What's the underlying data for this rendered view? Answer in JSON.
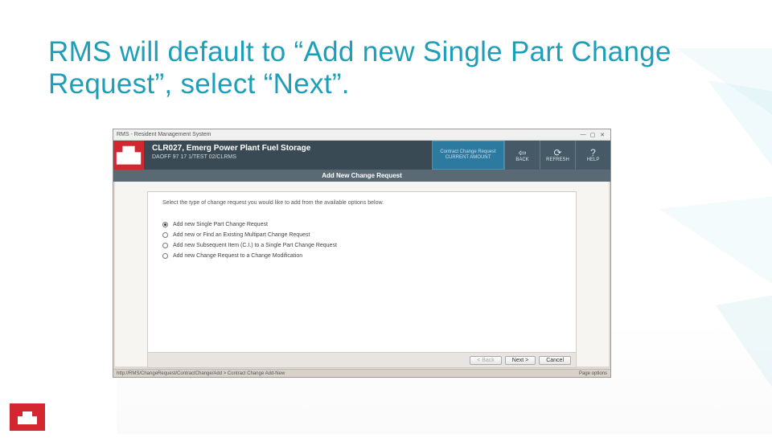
{
  "slide": {
    "title": "RMS will default to “Add new Single Part Change Request”, select “Next”."
  },
  "app": {
    "window_title": "RMS - Resident Management System",
    "header_title": "CLR027, Emerg Power Plant Fuel Storage",
    "header_subtitle": "DAOFF 97 17 1/TEST 02/CLRMS",
    "summary_box": {
      "line1": "Contract Change Request",
      "line2": "CURRENT AMOUNT"
    },
    "action_back": "BACK",
    "action_refresh": "REFRESH",
    "action_help": "HELP",
    "section_title": "Add New Change Request",
    "form_intro": "Select the type of change request you would like to add from the available options below.",
    "options": [
      "Add new Single Part Change Request",
      "Add new or Find an Existing Multipart Change Request",
      "Add new Subsequent Item (C.I.) to a Single Part Change Request",
      "Add new Change Request to a Change Modification"
    ],
    "wizard": {
      "back": "< Back",
      "next": "Next >",
      "cancel": "Cancel"
    },
    "status_left": "http://RMS/ChangeRequest/ContractChange/Add > Contract Change Add-New",
    "status_right": "Page options"
  }
}
